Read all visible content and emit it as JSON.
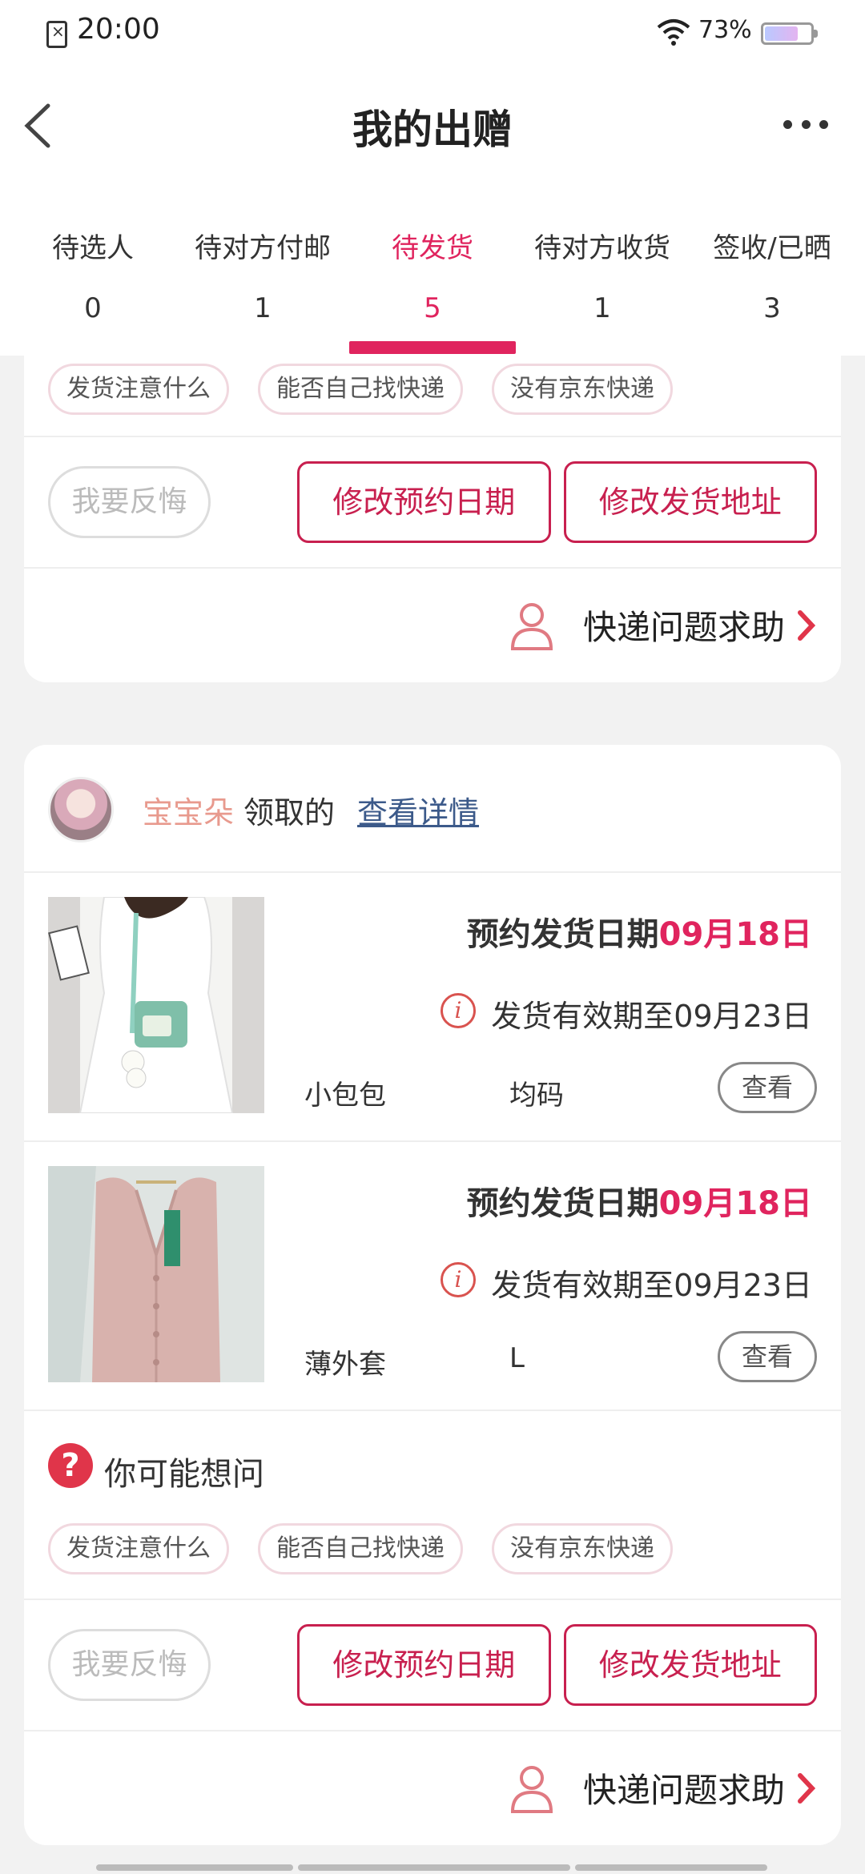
{
  "status": {
    "time": "20:00",
    "battery": "73%",
    "battery_level": 0.73
  },
  "nav": {
    "title": "我的出赠"
  },
  "tabs": [
    {
      "label": "待选人",
      "count": "0"
    },
    {
      "label": "待对方付邮",
      "count": "1"
    },
    {
      "label": "待发货",
      "count": "5"
    },
    {
      "label": "待对方收货",
      "count": "1"
    },
    {
      "label": "签收/已晒",
      "count": "3"
    }
  ],
  "chips": [
    "发货注意什么",
    "能否自己找快递",
    "没有京东快递"
  ],
  "actions": {
    "regret": "我要反悔",
    "change_date": "修改预约日期",
    "change_address": "修改发货地址",
    "help": "快递问题求助"
  },
  "card2": {
    "donor_name": "宝宝朵",
    "donor_mid": "领取的",
    "details_link": "查看详情",
    "items": [
      {
        "date_label": "预约发货日期",
        "date": "09月18日",
        "valid": "发货有效期至09月23日",
        "name": "小包包",
        "size": "均码",
        "view": "查看"
      },
      {
        "date_label": "预约发货日期",
        "date": "09月18日",
        "valid": "发货有效期至09月23日",
        "name": "薄外套",
        "size": "L",
        "view": "查看"
      }
    ],
    "ask_title": "你可能想问"
  },
  "colors": {
    "accent": "#e0245e",
    "link": "#3c5a8a",
    "donor": "#e89a8e"
  }
}
